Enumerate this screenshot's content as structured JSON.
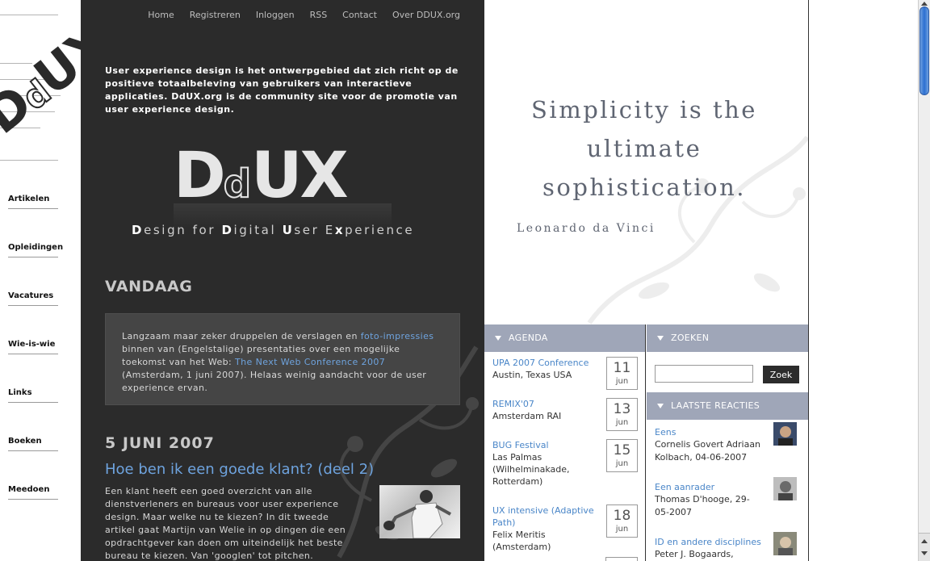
{
  "site": {
    "logo_text": "DdUX",
    "tagline_parts": [
      "D",
      "esign for ",
      "D",
      "igital ",
      "U",
      "ser E",
      "x",
      "perience"
    ]
  },
  "sidenav": {
    "items": [
      {
        "label": "Artikelen"
      },
      {
        "label": "Opleidingen"
      },
      {
        "label": "Vacatures"
      },
      {
        "label": "Wie-is-wie"
      },
      {
        "label": "Links"
      },
      {
        "label": "Boeken"
      },
      {
        "label": "Meedoen"
      }
    ]
  },
  "topnav": {
    "items": [
      {
        "label": "Home"
      },
      {
        "label": "Registreren"
      },
      {
        "label": "Inloggen"
      },
      {
        "label": "RSS"
      },
      {
        "label": "Contact"
      },
      {
        "label": "Over DDUX.org"
      }
    ]
  },
  "intro": "User experience design is het ontwerpgebied dat zich richt op de positieve totaalbeleving van gebruikers van interactieve applicaties. DdUX.org is de community site voor de promotie van user experience design.",
  "vandaag": {
    "heading": "VANDAAG",
    "text_1": "Langzaam maar zeker druppelen de verslagen en ",
    "link_1": "foto-impressies",
    "text_2": " binnen van (Engelstalige) presentaties over een mogelijke toekomst van het Web: ",
    "link_2": "The Next Web Conference 2007",
    "text_3": " (Amsterdam, 1 juni 2007). Helaas weinig aandacht voor de user experience ervan."
  },
  "post": {
    "date": "5 JUNI 2007",
    "title": "Hoe ben ik een goede klant? (deel 2)",
    "body": "Een klant heeft een goed overzicht van alle dienstverleners en bureaus voor user experience design. Maar welke nu te kiezen? In dit tweede artikel gaat Martijn van Welie in op dingen die een opdrachtgever kan doen om uiteindelijk het beste bureau te kiezen. Van 'googlen' tot pitchen."
  },
  "quote": {
    "line1": "Simplicity is the",
    "line2": "ultimate",
    "line3": "sophistication.",
    "author": "Leonardo da Vinci"
  },
  "agenda": {
    "heading": "AGENDA",
    "items": [
      {
        "title": "UPA 2007 Conference",
        "location": "Austin, Texas USA",
        "day": "11",
        "month": "jun"
      },
      {
        "title": "REMIX'07",
        "location": "Amsterdam RAI",
        "day": "13",
        "month": "jun"
      },
      {
        "title": "BUG Festival",
        "location": "Las Palmas (Wilhelminakade, Rotterdam)",
        "day": "15",
        "month": "jun"
      },
      {
        "title": "UX intensive (Adaptive Path)",
        "location": "Felix Meritis (Amsterdam)",
        "day": "18",
        "month": "jun"
      }
    ]
  },
  "zoeken": {
    "heading": "ZOEKEN",
    "button": "Zoek",
    "value": ""
  },
  "reacties": {
    "heading": "LAATSTE REACTIES",
    "items": [
      {
        "title": "Eens",
        "author": "Cornelis Govert Adriaan Kolbach, 04-06-2007"
      },
      {
        "title": "Een aanrader",
        "author": "Thomas D'hooge, 29-05-2007"
      },
      {
        "title": "ID en andere disciplines",
        "author": "Peter J. Bogaards,"
      }
    ]
  },
  "colors": {
    "dark_bg": "#2b2b2b",
    "link_blue": "#6ea3de",
    "header_bar": "#9fa6b8",
    "quote_text": "#5f6572"
  }
}
